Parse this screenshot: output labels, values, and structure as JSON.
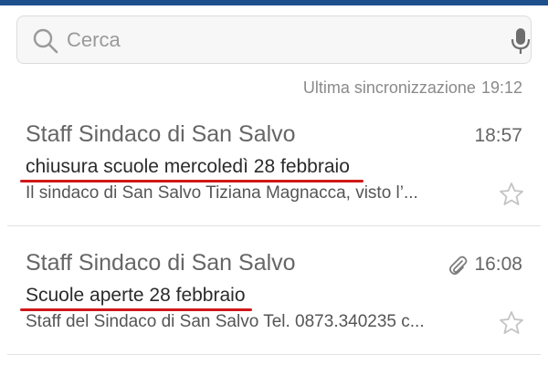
{
  "search": {
    "placeholder": "Cerca"
  },
  "sync": {
    "label": "Ultima sincronizzazione",
    "time": "19:12"
  },
  "messages": [
    {
      "sender": "Staff Sindaco di San Salvo",
      "time": "18:57",
      "subject": "chiusura scuole mercoledì 28 febbraio",
      "preview": "Il sindaco di San Salvo Tiziana Magnacca, visto l’...",
      "has_attachment": false,
      "starred": false
    },
    {
      "sender": "Staff Sindaco di San Salvo",
      "time": "16:08",
      "subject": "Scuole aperte 28 febbraio",
      "preview": "Staff del Sindaco di San Salvo Tel. 0873.340235 c...",
      "has_attachment": true,
      "starred": false
    }
  ],
  "colors": {
    "accent_bar": "#1d4f8c",
    "annotation_underline": "#d01818"
  }
}
